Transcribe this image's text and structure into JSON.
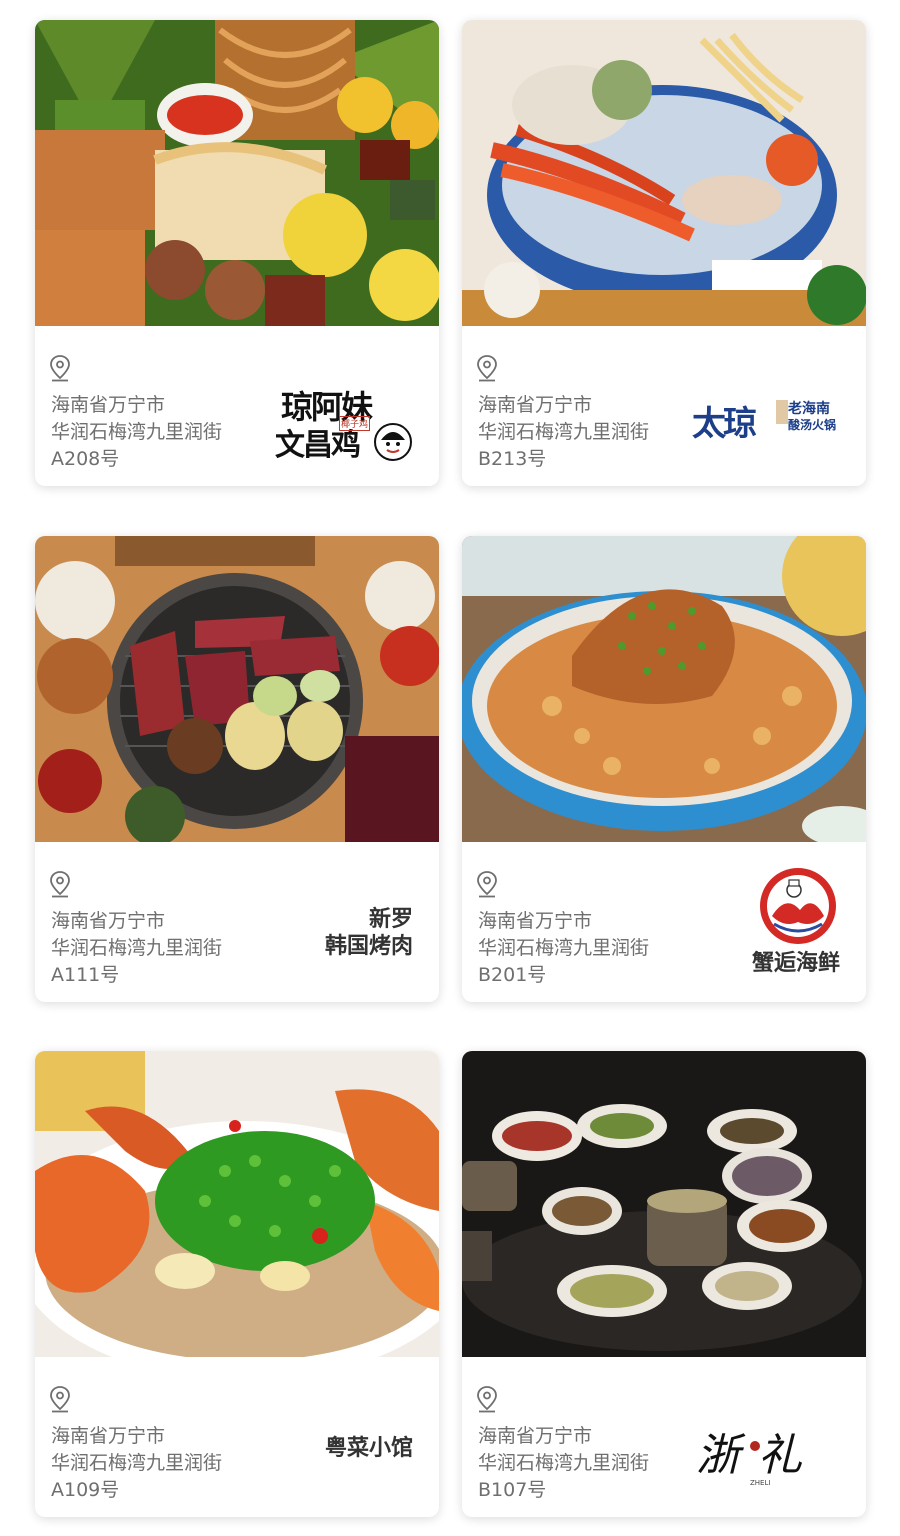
{
  "cards": [
    {
      "address_line1": "海南省万宁市",
      "address_line2": "华润石梅湾九里润街",
      "unit": "A208号",
      "brand_line1": "琼阿妹",
      "brand_line2": "文昌鸡",
      "brand_small": "椰子鸡"
    },
    {
      "address_line1": "海南省万宁市",
      "address_line2": "华润石梅湾九里润街",
      "unit": "B213号",
      "brand_main": "太琼",
      "brand_sub1": "老海南",
      "brand_sub2": "酸汤火锅"
    },
    {
      "address_line1": "海南省万宁市",
      "address_line2": "华润石梅湾九里润街",
      "unit": "A111号",
      "brand_line1": "新罗",
      "brand_line2": "韩国烤肉"
    },
    {
      "address_line1": "海南省万宁市",
      "address_line2": "华润石梅湾九里润街",
      "unit": "B201号",
      "brand_line1": "蟹逅海鲜"
    },
    {
      "address_line1": "海南省万宁市",
      "address_line2": "华润石梅湾九里润街",
      "unit": "A109号",
      "brand_line1": "粤菜小馆"
    },
    {
      "address_line1": "海南省万宁市",
      "address_line2": "华润石梅湾九里润街",
      "unit": "B107号",
      "brand_line1": "浙礼",
      "brand_small": "ZHELI"
    }
  ]
}
